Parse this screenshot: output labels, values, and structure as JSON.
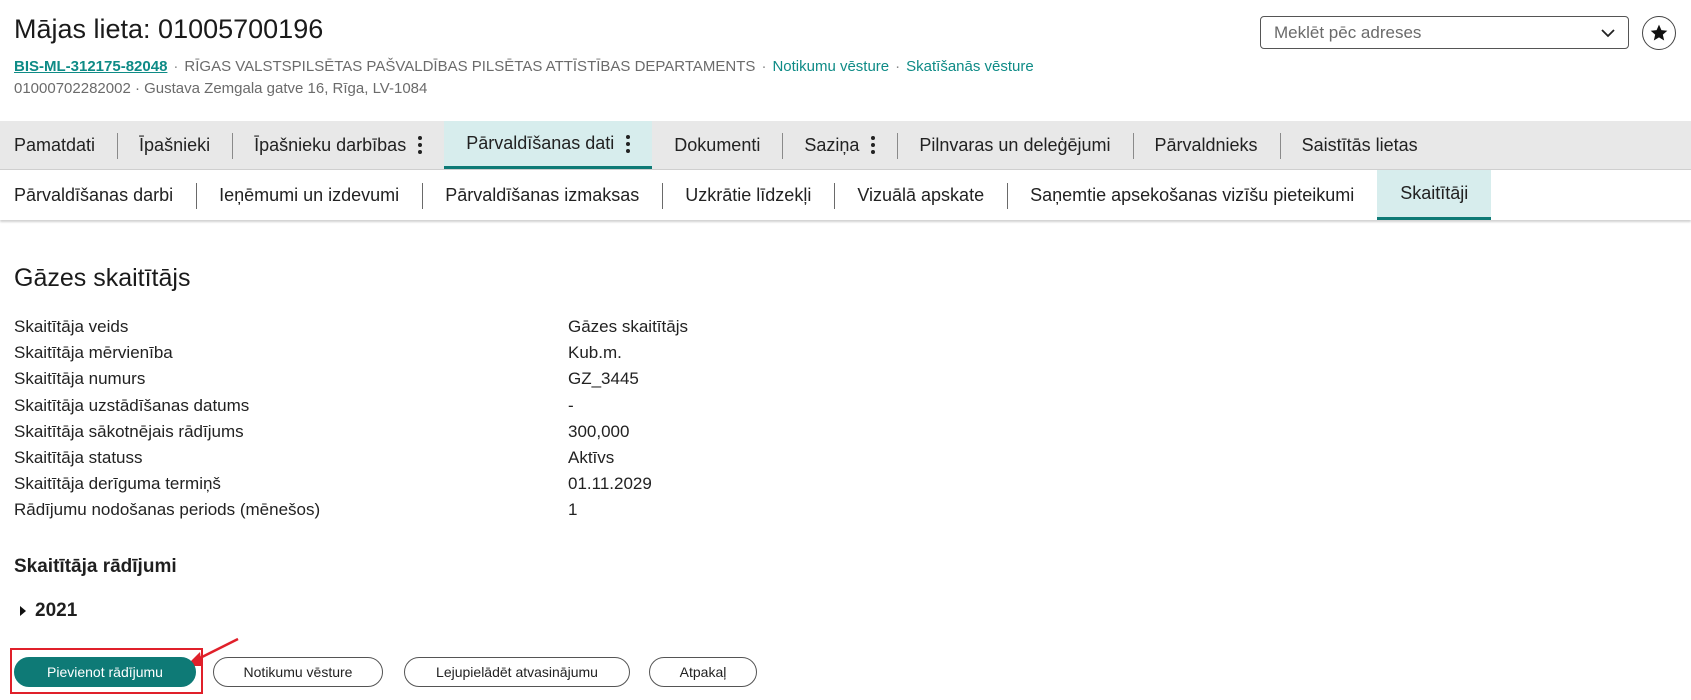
{
  "header": {
    "title": "Mājas lieta: 01005700196",
    "case_id": "BIS-ML-312175-82048",
    "organization": "RĪGAS VALSTSPILSĒTAS PAŠVALDĪBAS PILSĒTAS ATTĪSTĪBAS DEPARTAMENTS",
    "events_history_link": "Notikumu vēsture",
    "view_history_link": "Skatīšanās vēsture",
    "address_line": "01000702282002 · Gustava Zemgala gatve 16, Rīga, LV-1084",
    "search_placeholder": "Meklēt pēc adreses"
  },
  "main_tabs": [
    {
      "label": "Pamatdati"
    },
    {
      "label": "Īpašnieki"
    },
    {
      "label": "Īpašnieku darbības"
    },
    {
      "label": "Pārvaldīšanas dati"
    },
    {
      "label": "Dokumenti"
    },
    {
      "label": "Saziņa"
    },
    {
      "label": "Pilnvaras un deleģējumi"
    },
    {
      "label": "Pārvaldnieks"
    },
    {
      "label": "Saistītās lietas"
    }
  ],
  "sub_tabs": [
    {
      "label": "Pārvaldīšanas darbi"
    },
    {
      "label": "Ieņēmumi un izdevumi"
    },
    {
      "label": "Pārvaldīšanas izmaksas"
    },
    {
      "label": "Uzkrātie līdzekļi"
    },
    {
      "label": "Vizuālā apskate"
    },
    {
      "label": "Saņemtie apsekošanas vizīšu pieteikumi"
    },
    {
      "label": "Skaitītāji"
    }
  ],
  "meter": {
    "title": "Gāzes skaitītājs",
    "properties": [
      {
        "label": "Skaitītāja veids",
        "value": "Gāzes skaitītājs"
      },
      {
        "label": "Skaitītāja mērvienība",
        "value": "Kub.m."
      },
      {
        "label": "Skaitītāja numurs",
        "value": "GZ_3445"
      },
      {
        "label": "Skaitītāja uzstādīšanas datums",
        "value": "-"
      },
      {
        "label": "Skaitītāja sākotnējais rādījums",
        "value": "300,000"
      },
      {
        "label": "Skaitītāja statuss",
        "value": "Aktīvs"
      },
      {
        "label": "Skaitītāja derīguma termiņš",
        "value": "01.11.2029"
      },
      {
        "label": "Rādījumu nodošanas periods (mēnešos)",
        "value": "1"
      }
    ],
    "readings_title": "Skaitītāja rādījumi",
    "year": "2021"
  },
  "actions": {
    "add_reading": "Pievienot rādījumu",
    "event_history": "Notikumu vēsture",
    "download_statement": "Lejupielādēt atvasinājumu",
    "back": "Atpakaļ"
  },
  "colors": {
    "accent": "#0e7a76",
    "link": "#0e8b86",
    "active_tab_bg": "#d7eded",
    "highlight": "#e0202a"
  }
}
